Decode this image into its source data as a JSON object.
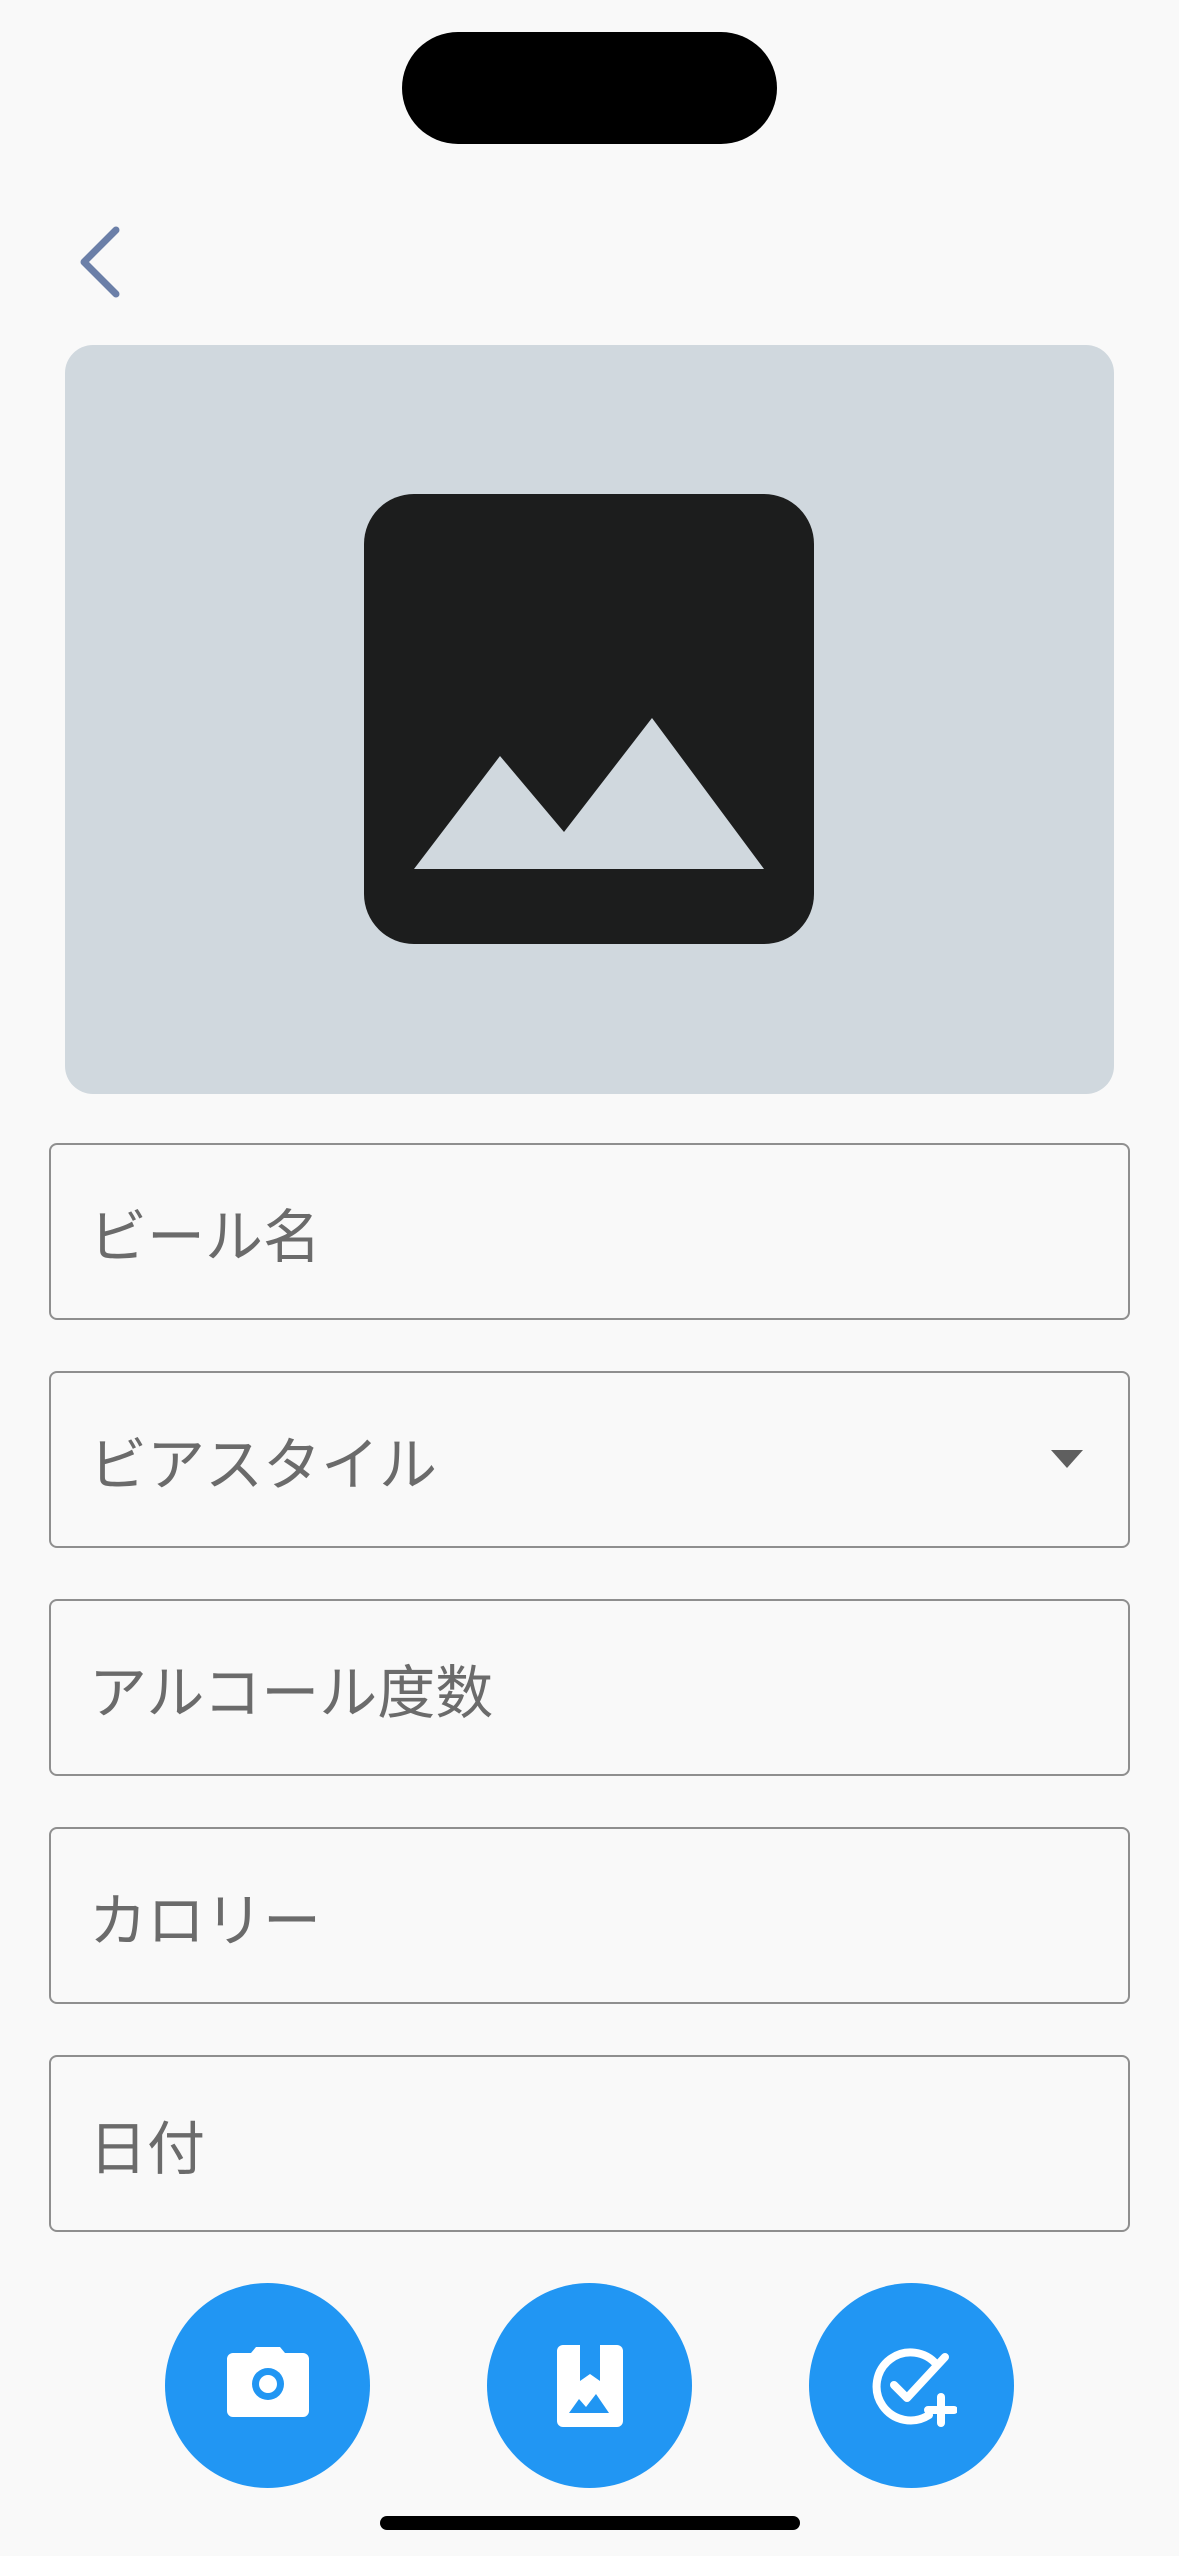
{
  "form": {
    "beer_name_label": "ビール名",
    "beer_style_label": "ビアスタイル",
    "abv_label": "アルコール度数",
    "calories_label": "カロリー",
    "date_label": "日付"
  },
  "icons": {
    "back": "chevron-left-icon",
    "photo_placeholder": "image-placeholder-icon",
    "camera": "camera-icon",
    "gallery": "photo-album-icon",
    "save": "add-task-icon",
    "dropdown": "arrow-drop-down-icon"
  },
  "colors": {
    "background": "#f9f9f9",
    "photo_placeholder_bg": "#d0d8de",
    "accent": "#2196f3",
    "back_chevron": "#6b7fa8",
    "field_border": "#8f8f8f",
    "label_text": "#6b6b6b"
  }
}
